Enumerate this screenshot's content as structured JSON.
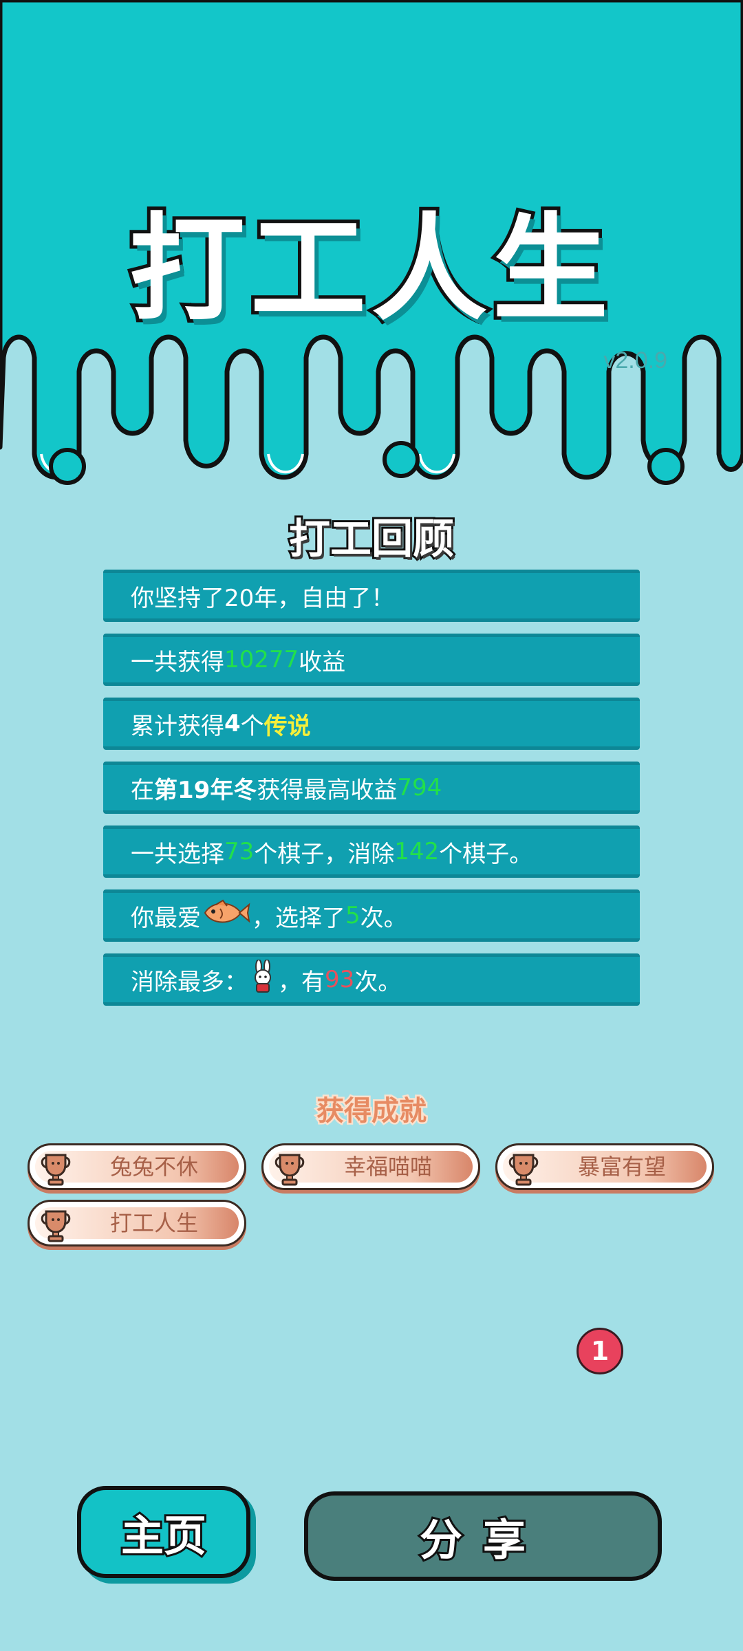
{
  "header": {
    "title": "打工人生",
    "version": "v2.0.9"
  },
  "review": {
    "title": "打工回顾",
    "rows": [
      {
        "parts": [
          {
            "t": "你坚持了20年，自由了！",
            "c": ""
          }
        ]
      },
      {
        "parts": [
          {
            "t": "一共获得",
            "c": ""
          },
          {
            "t": "10277",
            "c": "g"
          },
          {
            "t": "收益",
            "c": ""
          }
        ]
      },
      {
        "parts": [
          {
            "t": "累计获得",
            "c": ""
          },
          {
            "t": "4",
            "c": "b"
          },
          {
            "t": "个",
            "c": ""
          },
          {
            "t": "传说",
            "c": "y"
          }
        ]
      },
      {
        "parts": [
          {
            "t": "在 ",
            "c": ""
          },
          {
            "t": "第19年冬",
            "c": "b"
          },
          {
            "t": " 获得最高收益",
            "c": ""
          },
          {
            "t": "794",
            "c": "g"
          }
        ]
      },
      {
        "parts": [
          {
            "t": "一共选择",
            "c": ""
          },
          {
            "t": "73",
            "c": "g"
          },
          {
            "t": "个棋子，消除",
            "c": ""
          },
          {
            "t": "142",
            "c": "g"
          },
          {
            "t": "个棋子。",
            "c": ""
          }
        ]
      },
      {
        "parts": [
          {
            "t": "你最爱",
            "c": ""
          },
          {
            "icon": "fish-icon"
          },
          {
            "t": "，选择了",
            "c": ""
          },
          {
            "t": "5",
            "c": "g"
          },
          {
            "t": "次。",
            "c": ""
          }
        ]
      },
      {
        "parts": [
          {
            "t": "消除最多：",
            "c": ""
          },
          {
            "icon": "rabbit-icon"
          },
          {
            "t": "，有",
            "c": ""
          },
          {
            "t": "93",
            "c": "r"
          },
          {
            "t": "次。",
            "c": ""
          }
        ]
      }
    ]
  },
  "achievements": {
    "title": "获得成就",
    "items": [
      "兔兔不休",
      "幸福喵喵",
      "暴富有望",
      "打工人生"
    ]
  },
  "notification": {
    "count": "1"
  },
  "buttons": {
    "home": "主页",
    "share": "分享"
  },
  "colors": {
    "sky": "#13c6c9",
    "background": "#a2dfe6",
    "row": "#10a0b0",
    "highlight_green": "#22e04a",
    "highlight_yellow": "#f5ef3a",
    "highlight_red": "#e8515c"
  }
}
